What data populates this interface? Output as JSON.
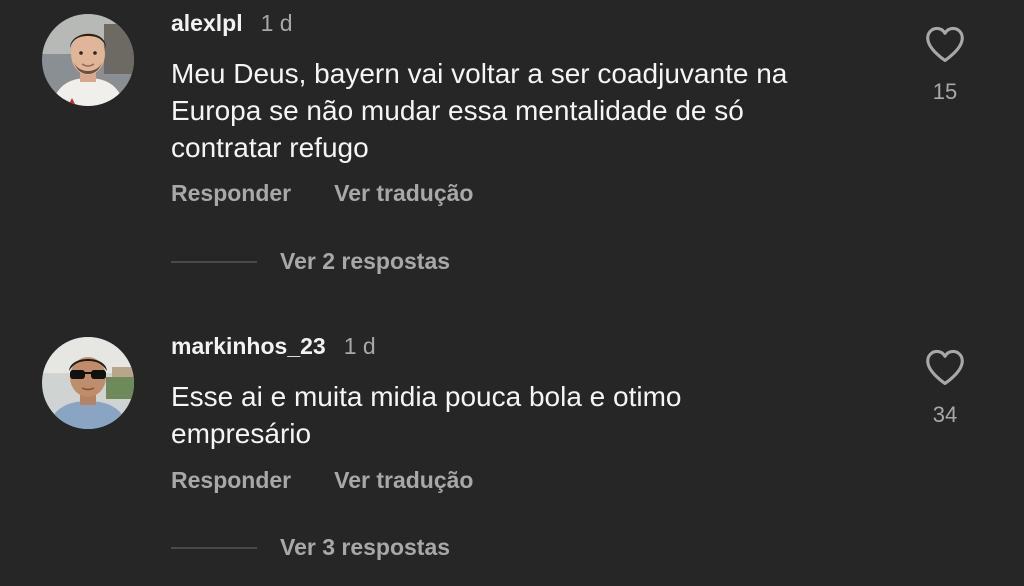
{
  "comments": [
    {
      "username": "alexlpl",
      "time": "1 d",
      "text": "Meu Deus, bayern vai voltar a ser coadjuvante na\nEuropa se não mudar essa mentalidade de só\ncontratar refugo",
      "likes": "15",
      "reply_label": "Responder",
      "translate_label": "Ver tradução",
      "replies_label": "Ver 2 respostas",
      "avatar_icon": "user-photo-avatar"
    },
    {
      "username": "markinhos_23",
      "time": "1 d",
      "text": "Esse ai e muita midia pouca bola e otimo\nempresário",
      "likes": "34",
      "reply_label": "Responder",
      "translate_label": "Ver tradução",
      "replies_label": "Ver 3 respostas",
      "avatar_icon": "user-photo-avatar"
    }
  ],
  "icons": {
    "like": "heart-outline-icon"
  },
  "colors": {
    "background": "#262626",
    "primary_text": "#f5f5f5",
    "secondary_text": "#a8a8a8"
  }
}
